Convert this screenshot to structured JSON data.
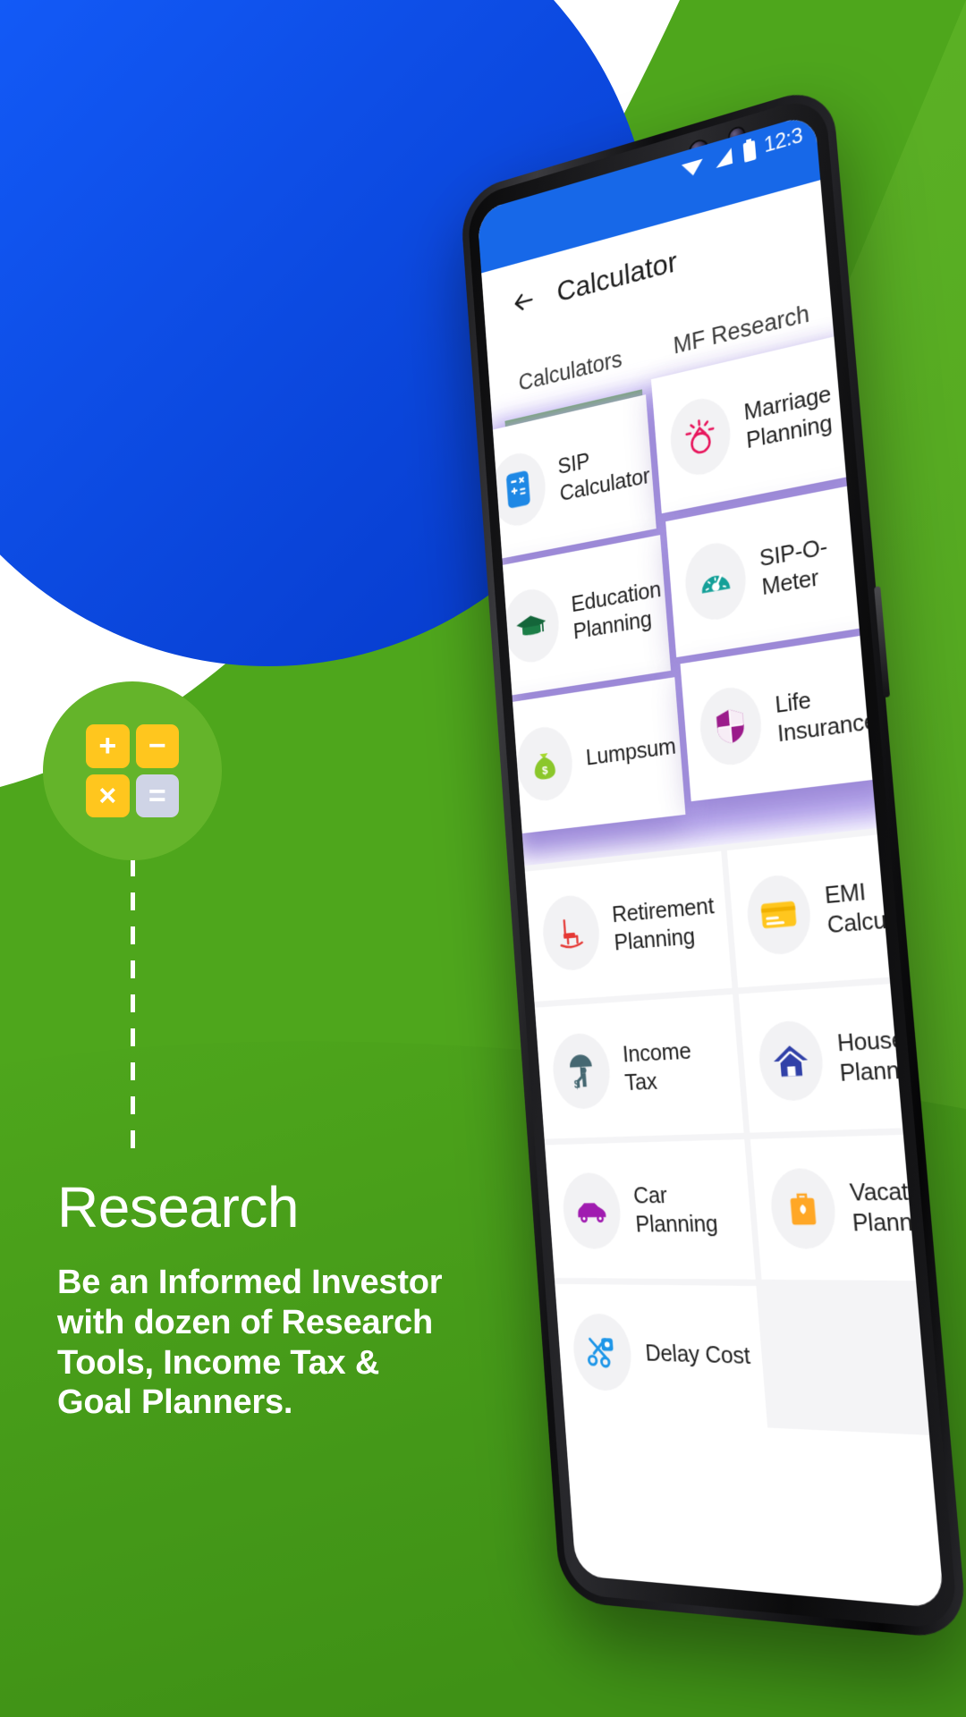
{
  "promo": {
    "heading": "Research",
    "body": "Be an Informed Investor with dozen of Research Tools, Income Tax & Goal Planners.",
    "badge_icon_keys": [
      "+",
      "−",
      "×",
      "="
    ]
  },
  "colors": {
    "green_light": "#64B42A",
    "green_mid": "#58AB20",
    "green_dark": "#46A019",
    "blue_circle": "#0B4FEE",
    "accent_blue": "#1768E8",
    "tab_underline": "#4CA81E",
    "badge_key": "#FFC61E",
    "badge_key_eq": "#CFD4E6",
    "white": "#FFFFFF"
  },
  "phone": {
    "statusbar": {
      "time": "12:3",
      "icons": [
        "wifi-icon",
        "signal-icon",
        "battery-icon"
      ]
    },
    "appbar": {
      "back_label": "back-arrow",
      "title": "Calculator"
    },
    "tabs": [
      {
        "label": "Calculators",
        "active": true
      },
      {
        "label": "MF Research",
        "active": false
      }
    ],
    "floating_cards": [
      {
        "label": "SIP Calculator",
        "icon": "calculator-icon",
        "color": "#1E88E5"
      },
      {
        "label": "Marriage Planning",
        "icon": "ring-icon",
        "color": "#E8175D"
      },
      {
        "label": "Education Planning",
        "icon": "graduation-icon",
        "color": "#14663A"
      },
      {
        "label": "SIP-O-Meter",
        "icon": "speedometer-icon",
        "color": "#14A098"
      },
      {
        "label": "Lumpsum",
        "icon": "money-bag-icon",
        "color": "#8BC72B"
      },
      {
        "label": "Life Insurance",
        "icon": "shield-icon",
        "color": "#9B1C8B"
      }
    ],
    "grid_cards": [
      {
        "label": "Retirement Planning",
        "icon": "rocking-chair-icon",
        "color": "#E53935"
      },
      {
        "label": "EMI Calculator",
        "icon": "credit-card-icon",
        "color": "#FFC61E"
      },
      {
        "label": "Income Tax",
        "icon": "umbrella-icon",
        "color": "#466872"
      },
      {
        "label": "House Planning",
        "icon": "house-icon",
        "color": "#3141A8"
      },
      {
        "label": "Car Planning",
        "icon": "car-icon",
        "color": "#A01CB0"
      },
      {
        "label": "Vacation Planning",
        "icon": "suitcase-icon",
        "color": "#FFA726"
      },
      {
        "label": "Delay Cost",
        "icon": "scissors-icon",
        "color": "#1E96E8"
      }
    ]
  }
}
